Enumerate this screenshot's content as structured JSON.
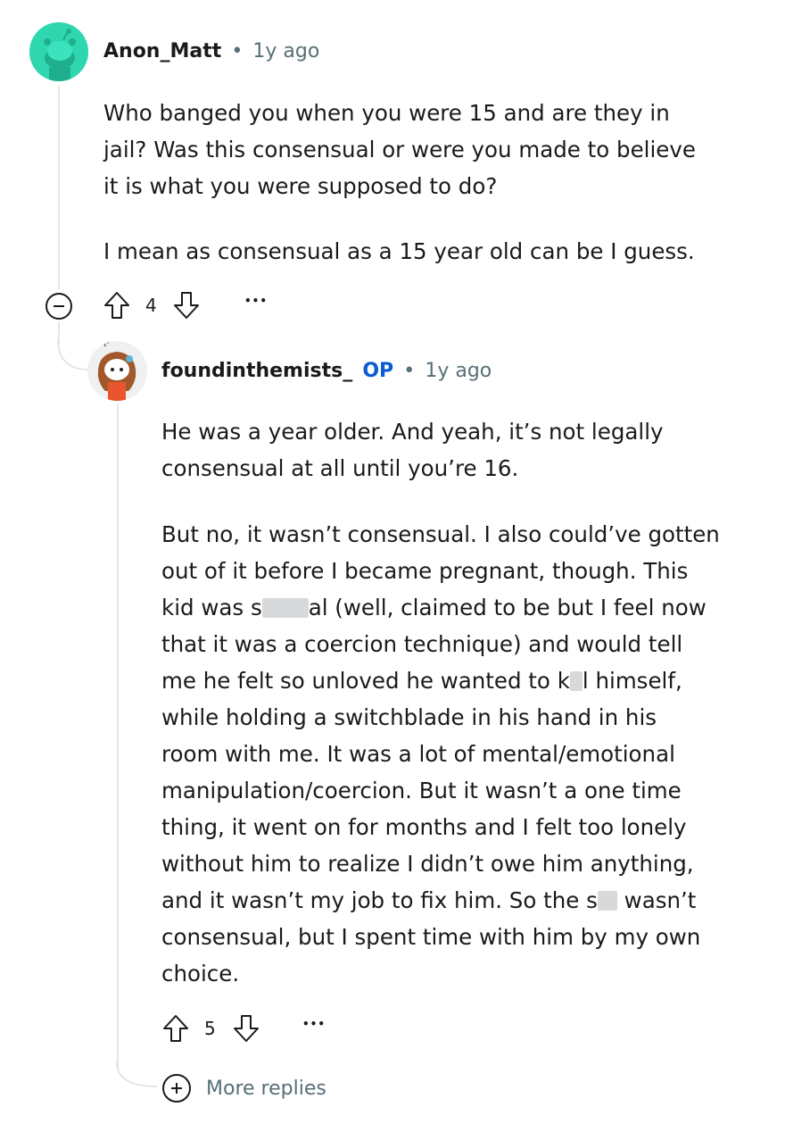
{
  "comments": [
    {
      "username": "Anon_Matt",
      "separator": "•",
      "time": "1y ago",
      "paragraphs": [
        "Who banged you when you were 15 and are they in\njail? Was this consensual or were you made to believe\nit is what you were supposed to do?",
        "I mean as consensual as a 15 year old can be I guess."
      ],
      "votes": "4",
      "more": "•••"
    },
    {
      "username": "foundinthemists_",
      "badge": "OP",
      "separator": "•",
      "time": "1y ago",
      "paragraph1": "He was a year older. And yeah, it’s not legally\nconsensual at all until you’re 16.",
      "p2_lines": {
        "l1": "But no, it wasn’t consensual. I also could’ve gotten",
        "l2": "out of it before I became pregnant, though. This",
        "l3a": "kid was s",
        "l3b": "al (well, claimed to be but I feel now",
        "l4": "that it was a coercion technique) and would tell",
        "l5a": "me he felt so unloved he wanted to k",
        "l5b": "l himself,",
        "l6": "while holding a switchblade in his hand in his",
        "l7": "room with me. It was a lot of mental/emotional",
        "l8": "manipulation/coercion. But it wasn’t a one time",
        "l9": "thing, it went on for months and I felt too lonely",
        "l10": "without him to realize I didn’t owe him anything,",
        "l11a": "and it wasn’t my job to fix him. So the s",
        "l11b": " wasn’t",
        "l12": "consensual, but I spent time with him by my own",
        "l13": "choice."
      },
      "votes": "5",
      "more": "•••"
    }
  ],
  "more_replies": "More replies",
  "icons": {
    "collapse": "minus-circle-icon",
    "upvote": "upvote-arrow-icon",
    "downvote": "downvote-arrow-icon",
    "overflow": "more-dots-icon",
    "expand": "plus-circle-icon"
  }
}
